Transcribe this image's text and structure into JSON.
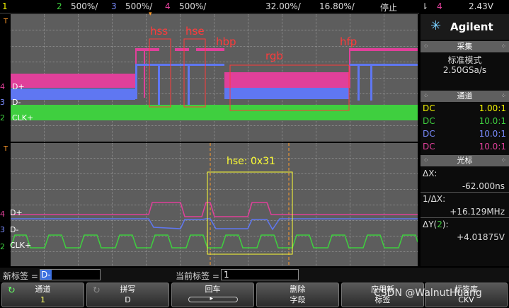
{
  "topbar": {
    "ch1_num": "1",
    "ch2_num": "2",
    "ch2_scale": "500%/",
    "ch3_num": "3",
    "ch3_scale": "500%/",
    "ch4_num": "4",
    "ch4_scale": "500%/",
    "time_offset": "32.00%/",
    "time_scale": "16.80%/",
    "run_status": "停止",
    "trigger_icon": "⇂",
    "trigger_ch": "4",
    "trigger_level": "2.43V"
  },
  "colors": {
    "ch_green": "#3fcf3f",
    "ch_blue": "#5f77f2",
    "ch_pink": "#e0409a",
    "annot_red": "#ff3a3a",
    "annot_yellow": "#ffff33",
    "marker_orange": "#ff9a2a"
  },
  "upper": {
    "annotations": {
      "hss": "hss",
      "hse": "hse",
      "hbp": "hbp",
      "rgb": "rgb",
      "hfp": "hfp"
    },
    "channel_labels": {
      "dplus": "D+",
      "dminus": "D-",
      "clk": "CLK+"
    }
  },
  "lower": {
    "decode_label": "hse: 0x31",
    "channel_labels": {
      "dplus": "D+",
      "dminus": "D-",
      "clk": "CLK+"
    }
  },
  "side": {
    "brand": "Agilent",
    "acq_header": "采集",
    "acq_mode": "标准模式",
    "acq_rate": "2.50GSa/s",
    "chan_header": "通道",
    "channels": [
      {
        "coupling": "DC",
        "ratio": "1.00:1"
      },
      {
        "coupling": "DC",
        "ratio": "10.0:1"
      },
      {
        "coupling": "DC",
        "ratio": "10.0:1"
      },
      {
        "coupling": "DC",
        "ratio": "10.0:1"
      }
    ],
    "cursor_header": "光标",
    "dx_label": "ΔX:",
    "dx_value": "-62.000ns",
    "inv_dx_label": "1/ΔX:",
    "inv_dx_value": "+16.129MHz",
    "dy_label_pre": "ΔY(",
    "dy_ch": "2",
    "dy_label_post": "):",
    "dy_value": "+4.01875V"
  },
  "labelbar": {
    "new_label_caption": "新标签 =",
    "new_label_value": "D-",
    "current_label_caption": "当前标签 =",
    "current_label_value": "1"
  },
  "softkeys": [
    {
      "line1": "通道",
      "line2": "1",
      "icon": "rotate-icon"
    },
    {
      "line1": "拼写",
      "line2": "D",
      "icon": "rotate-icon"
    },
    {
      "line1": "回车",
      "line2": ""
    },
    {
      "line1": "删除",
      "line2": "字段"
    },
    {
      "line1": "应用新",
      "line2": "标签"
    },
    {
      "line1": "标签库",
      "line2": "CKV"
    }
  ],
  "watermark": "CSDN @WalnutHuang"
}
